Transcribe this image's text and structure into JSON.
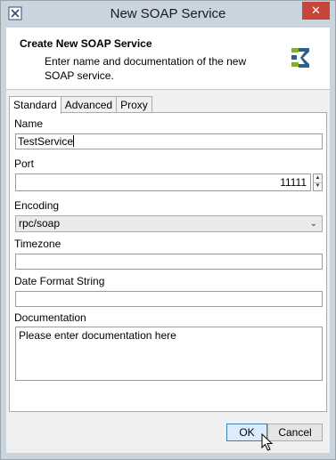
{
  "window": {
    "title": "New SOAP Service",
    "close_icon": "close-icon",
    "app_icon": "app-icon"
  },
  "header": {
    "title": "Create New SOAP Service",
    "description": "Enter name and documentation of the new SOAP service.",
    "logo_icon": "soap-service-logo-icon"
  },
  "tabs": [
    {
      "label": "Standard",
      "active": true
    },
    {
      "label": "Advanced",
      "active": false
    },
    {
      "label": "Proxy",
      "active": false
    }
  ],
  "form": {
    "name_label": "Name",
    "name_value": "TestService",
    "port_label": "Port",
    "port_value": "11111",
    "encoding_label": "Encoding",
    "encoding_value": "rpc/soap",
    "timezone_label": "Timezone",
    "timezone_value": "",
    "date_format_label": "Date Format String",
    "date_format_value": "",
    "documentation_label": "Documentation",
    "documentation_value": "Please enter documentation here"
  },
  "buttons": {
    "ok_label": "OK",
    "cancel_label": "Cancel"
  },
  "colors": {
    "titlebar": "#c9d4dd",
    "close_button": "#c7463b",
    "default_button_border": "#3c7fb1"
  }
}
